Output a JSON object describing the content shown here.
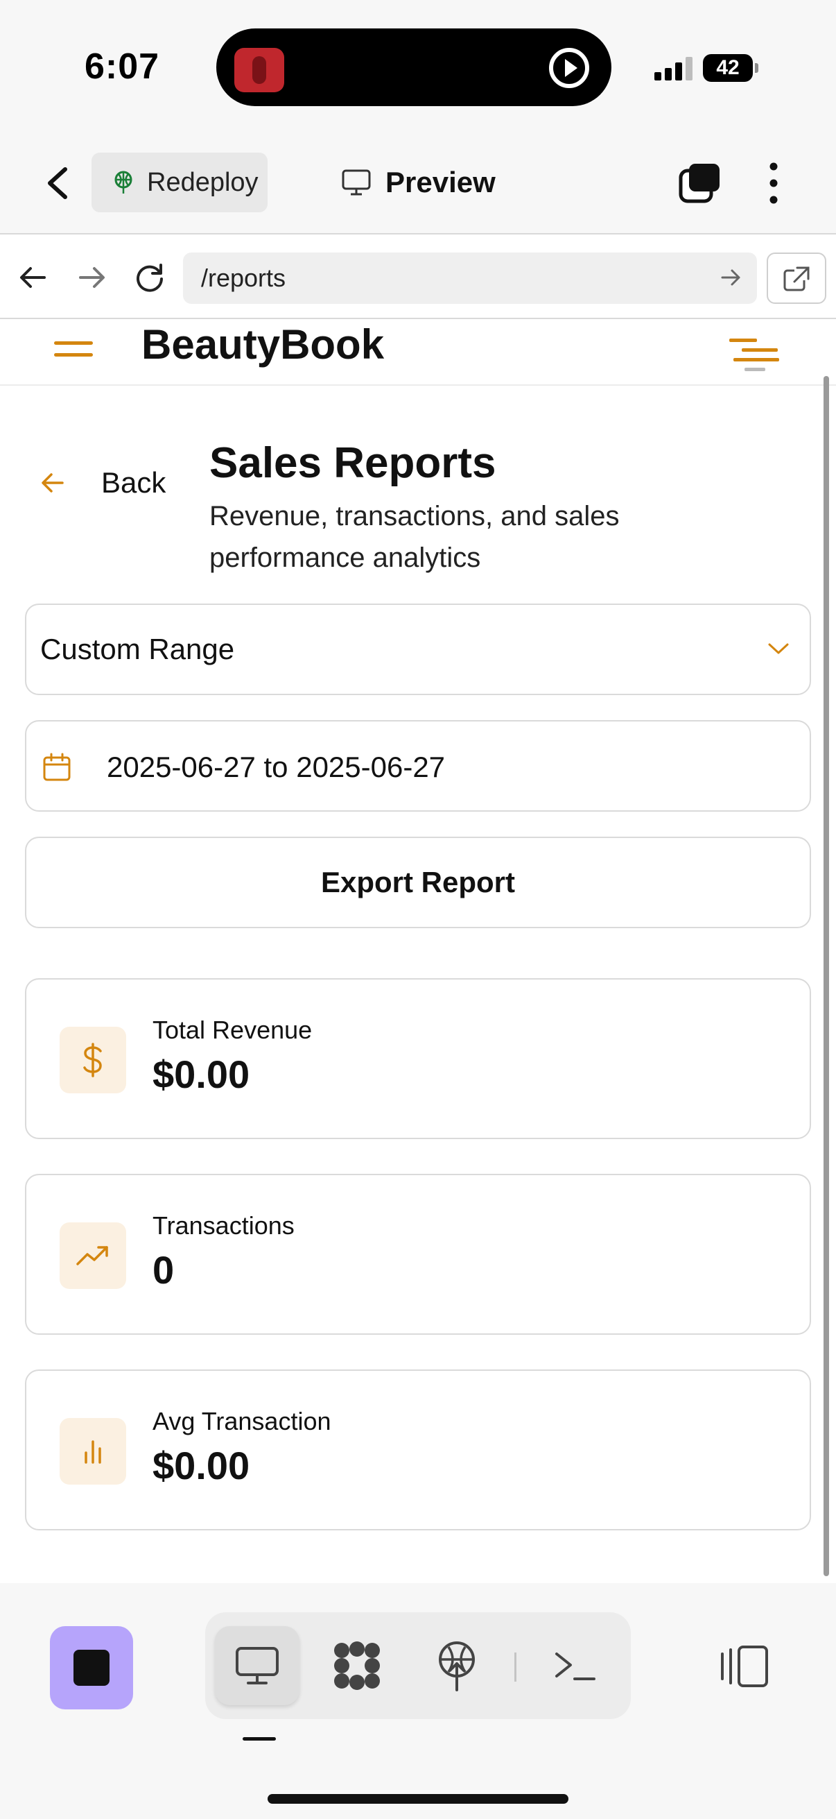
{
  "status_bar": {
    "time": "6:07",
    "battery": "42"
  },
  "app_header": {
    "redeploy_label": "Redeploy",
    "preview_label": "Preview"
  },
  "browser": {
    "url": "/reports"
  },
  "site": {
    "brand": "BeautyBook",
    "accent_color": "#d4860f"
  },
  "page": {
    "back_label": "Back",
    "title": "Sales Reports",
    "subtitle": "Revenue, transactions, and sales performance analytics",
    "range_select": "Custom Range",
    "date_range": "2025-06-27 to 2025-06-27",
    "export_label": "Export Report"
  },
  "stats": [
    {
      "label": "Total Revenue",
      "value": "$0.00",
      "icon": "dollar-icon"
    },
    {
      "label": "Transactions",
      "value": "0",
      "icon": "trending-up-icon"
    },
    {
      "label": "Avg Transaction",
      "value": "$0.00",
      "icon": "bar-chart-icon"
    }
  ],
  "toolbar": {
    "items": [
      "monitor-icon",
      "apps-icon",
      "deploy-icon",
      "terminal-icon"
    ],
    "stop_color": "#b6a4fb"
  }
}
